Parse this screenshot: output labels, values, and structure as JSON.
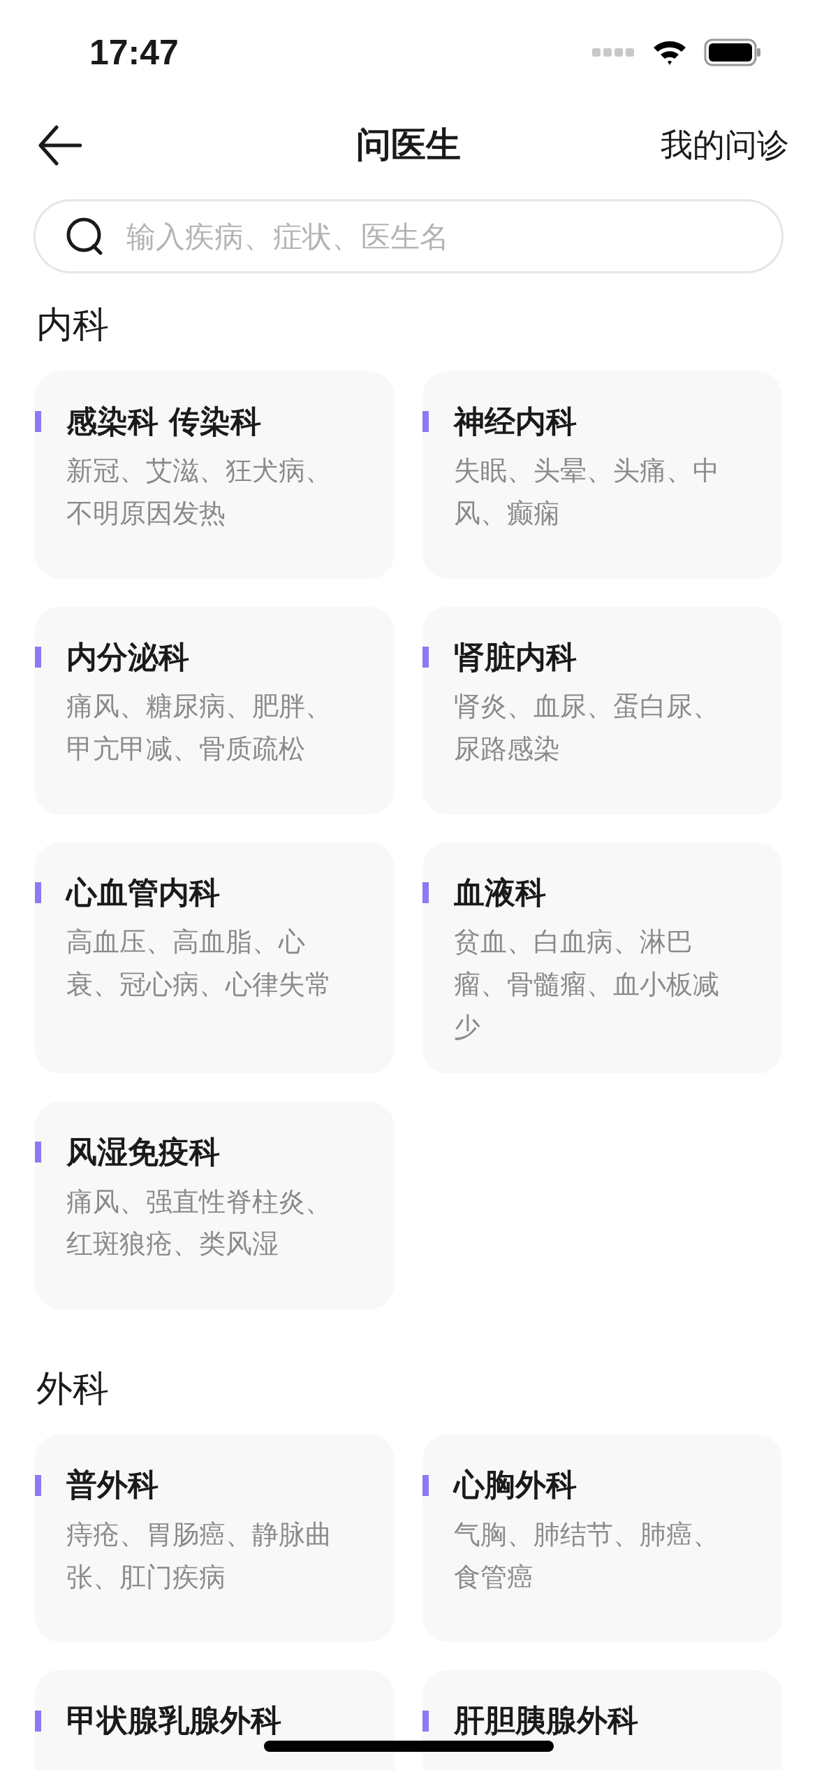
{
  "status_bar": {
    "time": "17:47"
  },
  "nav": {
    "title": "问医生",
    "action": "我的问诊"
  },
  "search": {
    "placeholder": "输入疾病、症状、医生名"
  },
  "sections": [
    {
      "title": "内科",
      "departments": [
        {
          "name": "感染科 传染科",
          "symptoms": "新冠、艾滋、狂犬病、不明原因发热"
        },
        {
          "name": "神经内科",
          "symptoms": "失眠、头晕、头痛、中风、癫痫"
        },
        {
          "name": "内分泌科",
          "symptoms": "痛风、糖尿病、肥胖、甲亢甲减、骨质疏松"
        },
        {
          "name": "肾脏内科",
          "symptoms": "肾炎、血尿、蛋白尿、尿路感染"
        },
        {
          "name": "心血管内科",
          "symptoms": "高血压、高血脂、心衰、冠心病、心律失常"
        },
        {
          "name": "血液科",
          "symptoms": "贫血、白血病、淋巴瘤、骨髓瘤、血小板减少"
        },
        {
          "name": "风湿免疫科",
          "symptoms": "痛风、强直性脊柱炎、红斑狼疮、类风湿"
        }
      ]
    },
    {
      "title": "外科",
      "departments": [
        {
          "name": "普外科",
          "symptoms": "痔疮、胃肠癌、静脉曲张、肛门疾病"
        },
        {
          "name": "心胸外科",
          "symptoms": "气胸、肺结节、肺癌、食管癌"
        },
        {
          "name": "甲状腺乳腺外科"
        },
        {
          "name": "肝胆胰腺外科"
        }
      ]
    }
  ]
}
